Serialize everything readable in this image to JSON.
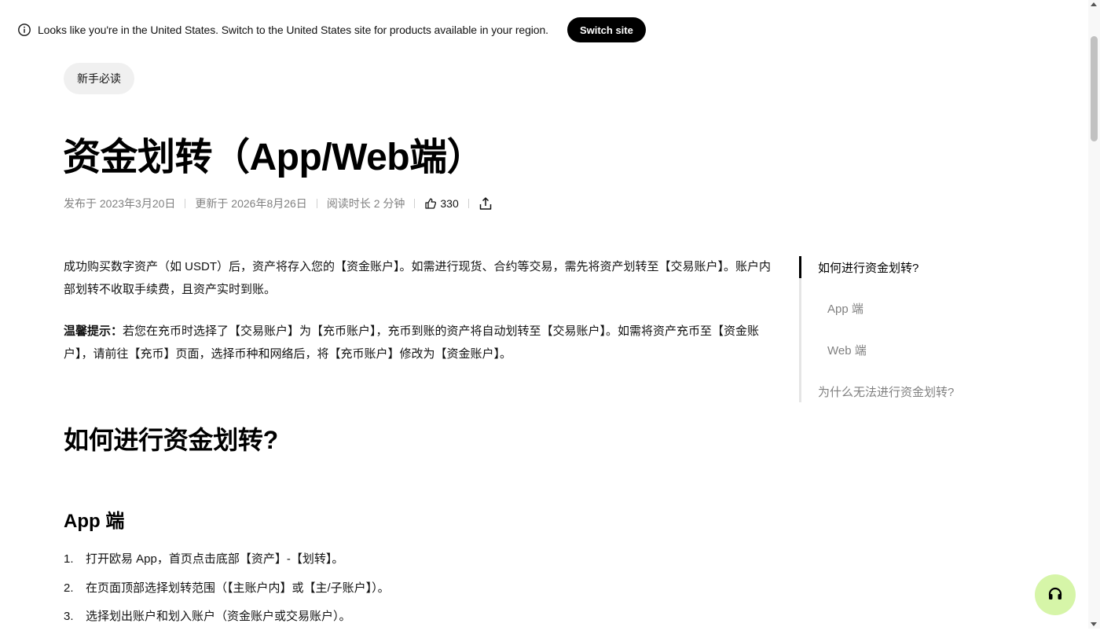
{
  "banner": {
    "text": "Looks like you're in the United States. Switch to the United States site for products available in your region.",
    "button_label": "Switch site",
    "icon": "info-icon"
  },
  "article": {
    "tag": "新手必读",
    "title": "资金划转（App/Web端）",
    "meta": {
      "published": "发布于 2023年3月20日",
      "updated": "更新于 2026年8月26日",
      "read_time": "阅读时长 2 分钟",
      "likes": "330",
      "like_icon": "thumbs-up-icon",
      "share_icon": "share-icon"
    },
    "intro": "成功购买数字资产（如 USDT）后，资产将存入您的【资金账户】。如需进行现货、合约等交易，需先将资产划转至【交易账户】。账户内部划转不收取手续费，且资产实时到账。",
    "tip_label": "温馨提示：",
    "tip_text": "若您在充币时选择了【交易账户】为【充币账户】，充币到账的资产将自动划转至【交易账户】。如需将资产充币至【资金账户】，请前往【充币】页面，选择币种和网络后，将【充币账户】修改为【资金账户】。",
    "h2": "如何进行资金划转?",
    "h3": "App 端",
    "steps": [
      {
        "num": "1.",
        "text": "打开欧易 App，首页点击底部【资产】-【划转】。"
      },
      {
        "num": "2.",
        "text": "在页面顶部选择划转范围（【主账户内】或【主/子账户】）。"
      },
      {
        "num": "3.",
        "text": "选择划出账户和划入账户（资金账户或交易账户）。"
      }
    ]
  },
  "toc": {
    "items": [
      {
        "label": "如何进行资金划转?",
        "active": true
      },
      {
        "label": "App 端"
      },
      {
        "label": "Web 端"
      },
      {
        "label": "为什么无法进行资金划转?"
      }
    ]
  },
  "support": {
    "icon": "headset-icon"
  },
  "colors": {
    "accent": "#d6f5a8",
    "text": "#121212",
    "muted": "#808080"
  }
}
